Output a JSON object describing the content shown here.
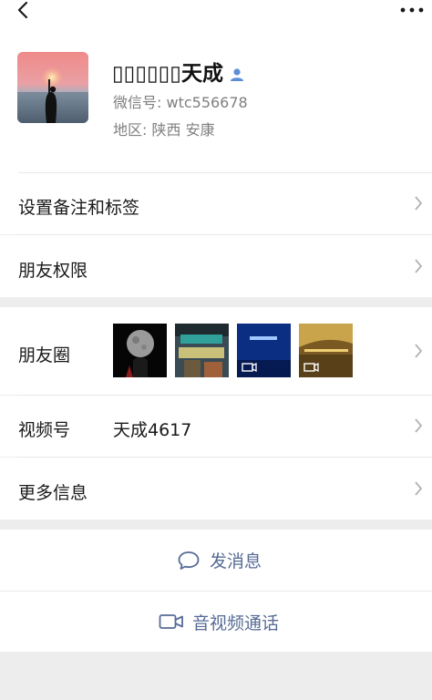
{
  "topbar": {
    "back_icon": "chevron-left-icon",
    "more_icon": "more-dots-icon"
  },
  "profile": {
    "name_display": "▯▯▯▯▯▯天成",
    "name_icon": "contact-person-icon",
    "wechat_id": "微信号: wtc556678",
    "region": "地区: 陕西  安康"
  },
  "menu": {
    "remark_tags": "设置备注和标签",
    "permissions": "朋友权限"
  },
  "info": {
    "moments_label": "朋友圈",
    "moments_thumbs": [
      {
        "type": "image",
        "subject": "moon"
      },
      {
        "type": "image",
        "subject": "night-street"
      },
      {
        "type": "video",
        "subject": "stage-blue"
      },
      {
        "type": "video",
        "subject": "mall-lights"
      }
    ],
    "channels_label": "视频号",
    "channels_value": "天成4617",
    "more_info_label": "更多信息"
  },
  "actions": {
    "message_label": "发消息",
    "message_icon": "chat-bubble-icon",
    "call_label": "音视频通话",
    "call_icon": "video-camera-icon"
  },
  "colors": {
    "link": "#576b95",
    "background": "#ededed",
    "divider": "#e8e8e8",
    "chevron": "#b2b2b2"
  }
}
